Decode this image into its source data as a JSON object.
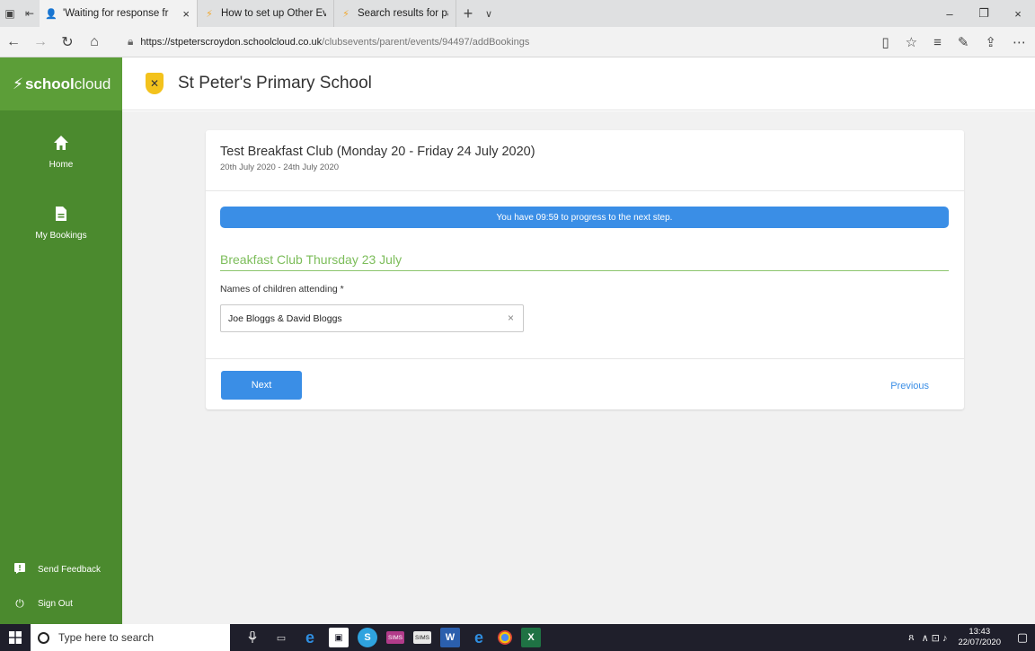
{
  "browser": {
    "tabs": [
      {
        "title": "'Waiting for response fr",
        "close": "×",
        "icon": "user-icon"
      },
      {
        "title": "How to set up Other Events",
        "icon": "schoolcloud-favicon"
      },
      {
        "title": "Search results for parent he",
        "icon": "schoolcloud-favicon"
      }
    ],
    "new_tab": "+",
    "tab_dropdown": "∨",
    "window_controls": {
      "minimize": "–",
      "restore": "❐",
      "close": "×"
    },
    "nav": {
      "back": "←",
      "forward": "→",
      "refresh": "↻",
      "home": "⌂"
    },
    "url_host": "https://stpeterscroydon.schoolcloud.co.uk",
    "url_path": "/clubsevents/parent/events/94497/addBookings",
    "toolbar_icons": {
      "reading": "▯",
      "favorite": "☆",
      "favorites_list": "≡",
      "notes": "✎",
      "share": "⇪",
      "more": "⋯"
    }
  },
  "app": {
    "brand_icon": "⚡",
    "brand_bold": "school",
    "brand_light": "cloud",
    "school_name": "St Peter's Primary School",
    "accent_color": "#4b8a2e",
    "primary_color": "#3a8ee6"
  },
  "sidebar": {
    "items": [
      {
        "label": "Home",
        "icon": "home-icon",
        "glyph": "⌂"
      },
      {
        "label": "My Bookings",
        "icon": "document-icon",
        "glyph": "▤"
      }
    ],
    "bottom": [
      {
        "label": "Send Feedback",
        "icon": "feedback-icon",
        "glyph": "!"
      },
      {
        "label": "Sign Out",
        "icon": "power-icon",
        "glyph": "⏻"
      }
    ]
  },
  "event": {
    "title": "Test Breakfast Club (Monday 20 - Friday 24 July 2020)",
    "dates": "20th July 2020 - 24th July 2020",
    "timer_message": "You have 09:59 to progress to the next step.",
    "section_title": "Breakfast Club Thursday 23 July",
    "field_label": "Names of children attending *",
    "field_value": "Joe Bloggs & David Bloggs",
    "clear_glyph": "×",
    "next_label": "Next",
    "previous_label": "Previous"
  },
  "taskbar": {
    "start_glyph": "⊞",
    "search_placeholder": "Type here to search",
    "apps": {
      "mic": "🎙",
      "taskview": "▭",
      "edge": "e",
      "store": "🛍",
      "skype": "S",
      "sims1": "SIMS",
      "sims2": "SIMS",
      "word": "W",
      "ie": "e",
      "excel": "X"
    },
    "tray_people": "ጸ",
    "tray_icons": "∧ ⊡ ♪",
    "time": "13:43",
    "date": "22/07/2020",
    "notification_glyph": "▢"
  }
}
